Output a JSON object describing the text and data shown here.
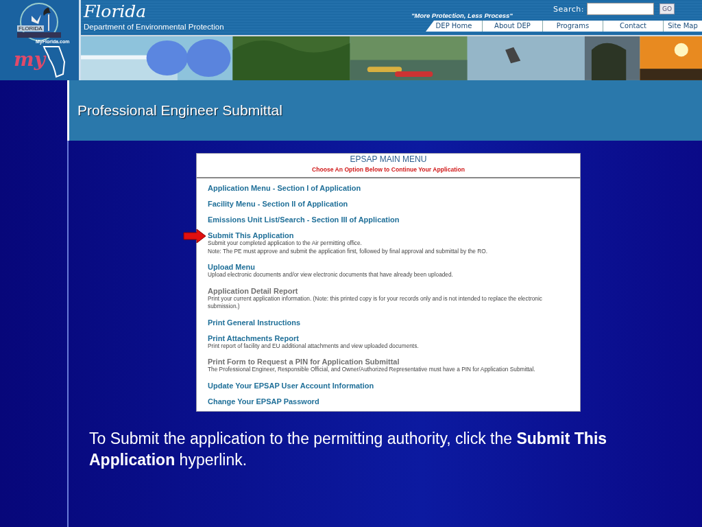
{
  "header": {
    "logo": {
      "seal_text": "FLORIDA",
      "site_text": "MyFlorida.com",
      "mark_text": "my"
    },
    "title": "Florida",
    "subtitle": "Department of Environmental Protection",
    "slogan": "\"More Protection, Less Process\"",
    "search": {
      "label": "Search:",
      "button": "GO"
    },
    "nav": [
      "DEP Home",
      "About DEP",
      "Programs",
      "Contact",
      "Site Map"
    ]
  },
  "slide_title": "Professional Engineer Submittal",
  "menu": {
    "title": "EPSAP MAIN MENU",
    "subtitle": "Choose An Option Below to Continue Your Application",
    "items": [
      {
        "label": "Application Menu - Section I of Application",
        "disabled": false,
        "pointed": false
      },
      {
        "label": "Facility Menu - Section II of Application",
        "disabled": false,
        "pointed": false
      },
      {
        "label": "Emissions Unit List/Search - Section III of Application",
        "disabled": false,
        "pointed": false
      },
      {
        "label": "Submit This Application",
        "description": [
          "Submit your completed application to the Air permitting office.",
          "Note: The PE must approve and submit the application first, followed by final approval and submittal by the RO."
        ],
        "disabled": false,
        "pointed": true
      },
      {
        "label": "Upload Menu",
        "description": [
          "Upload electronic documents and/or view electronic documents that have already been uploaded."
        ],
        "disabled": false,
        "pointed": false
      },
      {
        "label": "Application Detail Report",
        "description": [
          "Print your current application information. (Note: this printed copy is for your records only and is not intended to replace the electronic submission.)"
        ],
        "disabled": true,
        "pointed": false
      },
      {
        "label": "Print General Instructions",
        "disabled": false,
        "pointed": false
      },
      {
        "label": "Print Attachments Report",
        "description": [
          "Print report of facility and EU additional attachments and view uploaded documents."
        ],
        "disabled": false,
        "pointed": false
      },
      {
        "label": "Print Form to Request a PIN for Application Submittal",
        "description": [
          "The Professional Engineer, Responsible Official, and Owner/Authorized Representative must have a PIN for Application Submittal."
        ],
        "disabled": true,
        "pointed": false
      },
      {
        "label": "Update Your EPSAP User Account Information",
        "disabled": false,
        "pointed": false
      },
      {
        "label": "Change Your EPSAP Password",
        "disabled": false,
        "pointed": false
      }
    ]
  },
  "caption": "To Submit the application to the permitting authority, click the **Submit This Application** hyperlink."
}
